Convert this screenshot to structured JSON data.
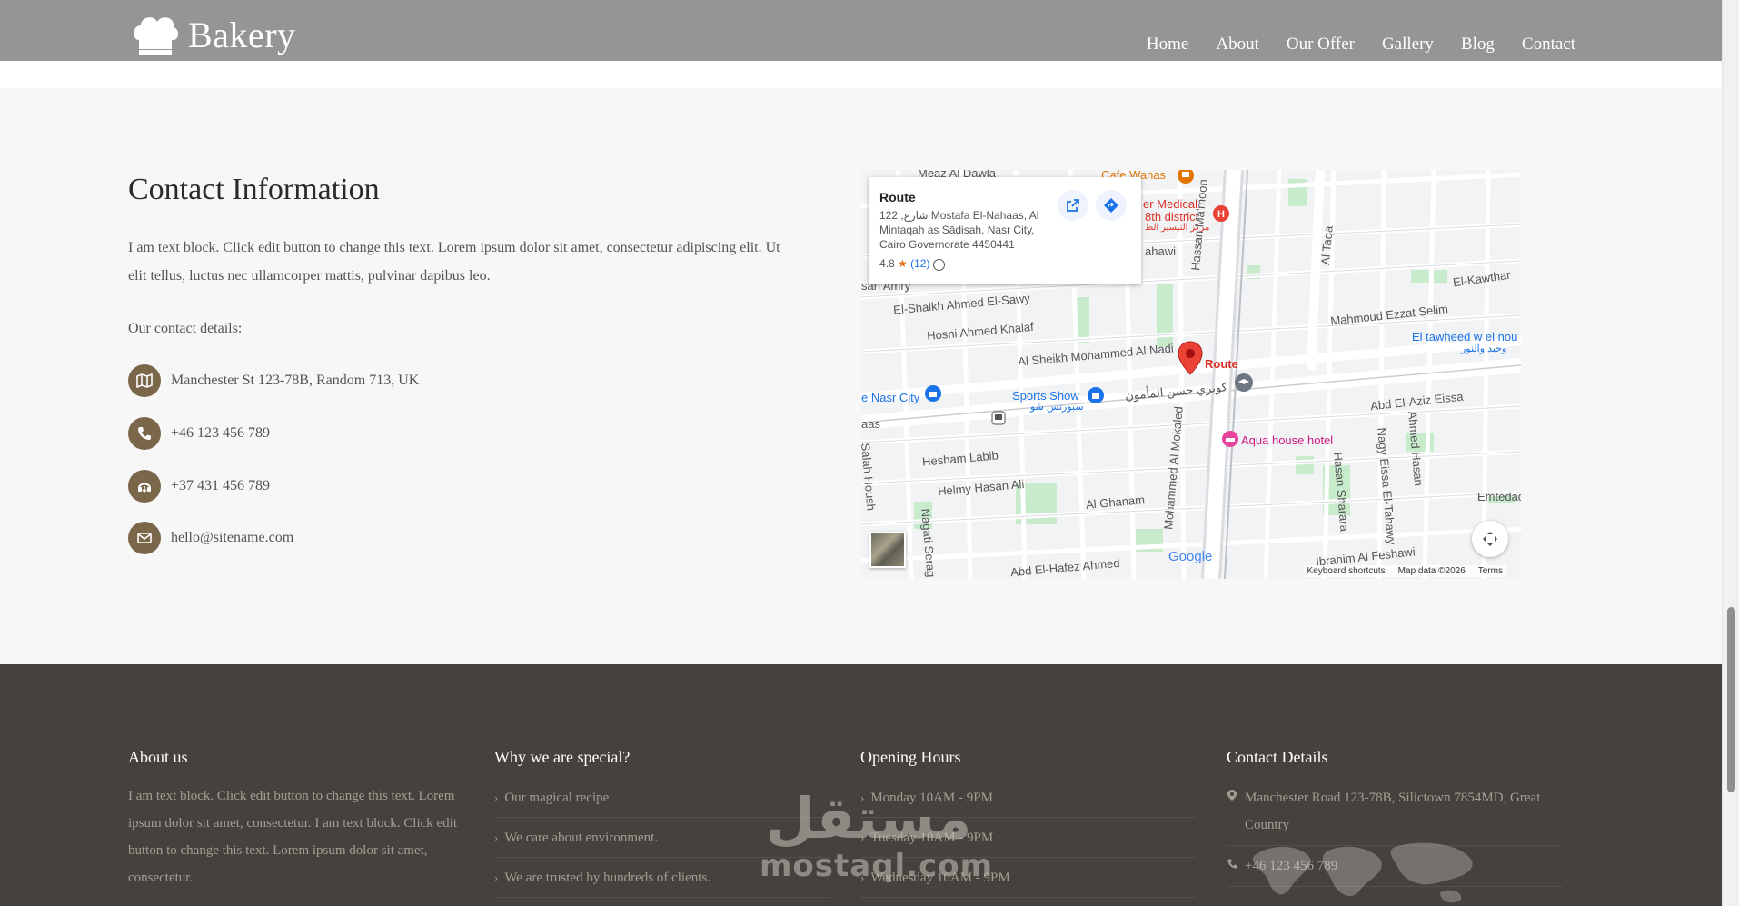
{
  "header": {
    "logo_text": "Bakery",
    "nav": [
      "Home",
      "About",
      "Our Offer",
      "Gallery",
      "Blog",
      "Contact"
    ]
  },
  "contact": {
    "title": "Contact Information",
    "text": "I am text block. Click edit button to change this text. Lorem ipsum dolor sit amet, consectetur adipiscing elit. Ut elit tellus, luctus nec ullamcorper mattis, pulvinar dapibus leo.",
    "subtitle": "Our contact details:",
    "items": [
      {
        "icon": "map-icon",
        "text": "Manchester St 123-78B, Random 713, UK"
      },
      {
        "icon": "phone-icon",
        "text": "+46 123 456 789"
      },
      {
        "icon": "headset-icon",
        "text": "+37 431 456 789"
      },
      {
        "icon": "envelope-icon",
        "text": "hello@sitename.com"
      }
    ]
  },
  "map": {
    "card_title": "Route",
    "card_address": "122 ,شارع Mostafa El-Nahaas, Al Mintaqah as Sādisah, Nasr City, Cairo Governorate 4450441",
    "rating": "4.8",
    "rating_count": "(12)",
    "pin_label": "Route",
    "labels": {
      "cafe": "Cafe Wanas",
      "medical": "er Medical",
      "medical2": "8th district",
      "medical3": "مركز التيسير الط",
      "ahawi": "ahawi",
      "amry": "san Amry",
      "sawy": "El-Shaikh Ahmed El-Sawy",
      "khalaf": "Hosni Ahmed Khalaf",
      "nadi": "Al Sheikh Mohammed Al Nadi",
      "nasr": "e Nasr City",
      "sports": "Sports Show",
      "sports_ar": "سبورتس شو",
      "kobri": "كوبري حسن المأمون",
      "hassan": "Hassan Ma'moon",
      "taqa": "Al Taqa",
      "kawthar": "El-Kawthar",
      "mahmoud": "Mahmoud Ezzat Selim",
      "tawheed": "El tawheed w el nou",
      "tawheed_ar": "وحيد والنور",
      "aziz": "Abd El-Aziz Eissa",
      "aqua": "Aqua house hotel",
      "labib": "Hesham Labib",
      "helmy": "Helmy Hasan Ali",
      "ghanam": "Al Ghanam",
      "salah": "Salah Housh",
      "nagati": "Nagati Serag",
      "mokaled": "Mohammed Al Mokaled",
      "sharara": "Hasan Sharara",
      "tahawy": "Nagy Eissa El-Tahawy",
      "ahmed_hasan": "Ahmed Hasan",
      "emtedad": "Emtedad",
      "feshawi": "Ibrahim Al Feshawi",
      "hafez": "Abd El-Hafez Ahmed",
      "meaz": "Meaz Al Dawla",
      "aas": "aas"
    },
    "google": "Google",
    "footer": [
      "Keyboard shortcuts",
      "Map data ©2026",
      "Terms"
    ]
  },
  "footer": {
    "about_title": "About us",
    "about_text": "I am text block. Click edit button to change this text. Lorem ipsum dolor sit amet, consectetur. I am text block. Click edit button to change this text. Lorem ipsum dolor sit amet, consectetur.",
    "special_title": "Why we are special?",
    "special_items": [
      "Our magical recipe.",
      "We care about environment.",
      "We are trusted by hundreds of clients."
    ],
    "hours_title": "Opening Hours",
    "hours_items": [
      "Monday 10AM - 9PM",
      "Tuesday 10AM - 9PM",
      "Wednesday 10AM - 9PM"
    ],
    "contact_title": "Contact Details",
    "contact_address": "Manchester Road 123-78B, Silictown 7854MD, Great Country",
    "contact_phone": "+46 123 456 789"
  },
  "watermark": {
    "arabic": "مستقل",
    "latin": "mostaql.com"
  },
  "colors": {
    "header_bg": "#959595",
    "accent": "#7a6649",
    "footer_bg": "#46413d",
    "section_bg": "#f7f7f7"
  }
}
